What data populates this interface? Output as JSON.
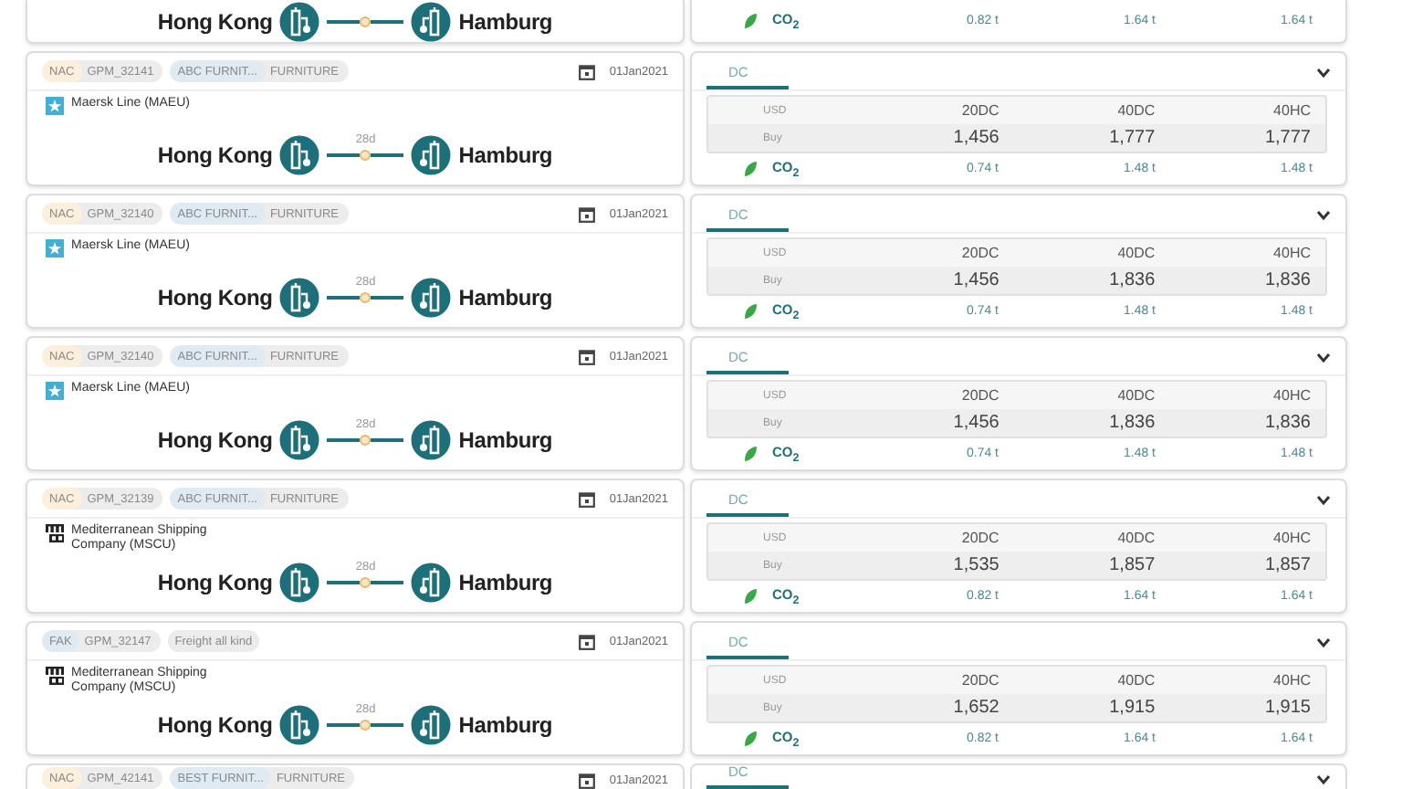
{
  "rows": [
    {
      "route": {
        "origin": "Hong Kong",
        "destination": "Hamburg"
      },
      "co2": {
        "label": "CO$_{2}$",
        "values": [
          "0.82 t",
          "1.64 t",
          "1.64 t"
        ]
      }
    },
    {
      "tags": [
        {
          "label": "NAC",
          "detail": "GPM_32141",
          "color": "#fcefdc"
        },
        {
          "label": "ABC FURNIT...",
          "detail": "FURNITURE",
          "color": "#dfeaf3"
        }
      ],
      "date": "01Jan2021",
      "carrier": {
        "name": "Maersk Line (MAEU)",
        "kind": "maersk"
      },
      "route": {
        "origin": "Hong Kong",
        "duration": "28d",
        "destination": "Hamburg"
      },
      "tabs": [
        {
          "label": "DC",
          "selected": true
        }
      ],
      "table": {
        "currency": "USD",
        "columns": [
          "20DC",
          "40DC",
          "40HC"
        ],
        "rows": [
          {
            "label": "Buy",
            "values": [
              "1,456",
              "1,777",
              "1,777"
            ]
          }
        ]
      },
      "co2": {
        "label": "CO$_{2}$",
        "values": [
          "0.74 t",
          "1.48 t",
          "1.48 t"
        ]
      }
    },
    {
      "tags": [
        {
          "label": "NAC",
          "detail": "GPM_32140",
          "color": "#fcefdc"
        },
        {
          "label": "ABC FURNIT...",
          "detail": "FURNITURE",
          "color": "#dfeaf3"
        }
      ],
      "date": "01Jan2021",
      "carrier": {
        "name": "Maersk Line (MAEU)",
        "kind": "maersk"
      },
      "route": {
        "origin": "Hong Kong",
        "duration": "28d",
        "destination": "Hamburg"
      },
      "tabs": [
        {
          "label": "DC",
          "selected": true
        }
      ],
      "table": {
        "currency": "USD",
        "columns": [
          "20DC",
          "40DC",
          "40HC"
        ],
        "rows": [
          {
            "label": "Buy",
            "values": [
              "1,456",
              "1,836",
              "1,836"
            ]
          }
        ]
      },
      "co2": {
        "label": "CO$_{2}$",
        "values": [
          "0.74 t",
          "1.48 t",
          "1.48 t"
        ]
      }
    },
    {
      "tags": [
        {
          "label": "NAC",
          "detail": "GPM_32140",
          "color": "#fcefdc"
        },
        {
          "label": "ABC FURNIT...",
          "detail": "FURNITURE",
          "color": "#dfeaf3"
        }
      ],
      "date": "01Jan2021",
      "carrier": {
        "name": "Maersk Line (MAEU)",
        "kind": "maersk"
      },
      "route": {
        "origin": "Hong Kong",
        "duration": "28d",
        "destination": "Hamburg"
      },
      "tabs": [
        {
          "label": "DC",
          "selected": true
        }
      ],
      "table": {
        "currency": "USD",
        "columns": [
          "20DC",
          "40DC",
          "40HC"
        ],
        "rows": [
          {
            "label": "Buy",
            "values": [
              "1,456",
              "1,836",
              "1,836"
            ]
          }
        ]
      },
      "co2": {
        "label": "CO$_{2}$",
        "values": [
          "0.74 t",
          "1.48 t",
          "1.48 t"
        ]
      }
    },
    {
      "tags": [
        {
          "label": "NAC",
          "detail": "GPM_32139",
          "color": "#fcefdc"
        },
        {
          "label": "ABC FURNIT...",
          "detail": "FURNITURE",
          "color": "#dfeaf3"
        }
      ],
      "date": "01Jan2021",
      "carrier": {
        "name": "Mediterranean Shipping Company (MSCU)",
        "kind": "msc"
      },
      "route": {
        "origin": "Hong Kong",
        "duration": "28d",
        "destination": "Hamburg"
      },
      "tabs": [
        {
          "label": "DC",
          "selected": true
        }
      ],
      "table": {
        "currency": "USD",
        "columns": [
          "20DC",
          "40DC",
          "40HC"
        ],
        "rows": [
          {
            "label": "Buy",
            "values": [
              "1,535",
              "1,857",
              "1,857"
            ]
          }
        ]
      },
      "co2": {
        "label": "CO$_{2}$",
        "values": [
          "0.82 t",
          "1.64 t",
          "1.64 t"
        ]
      }
    },
    {
      "tags": [
        {
          "label": "FAK",
          "detail": "GPM_32147",
          "color": "#dfeaf3"
        },
        {
          "label": "Freight all kind",
          "color": "#ececec"
        }
      ],
      "date": "01Jan2021",
      "carrier": {
        "name": "Mediterranean Shipping Company (MSCU)",
        "kind": "msc"
      },
      "route": {
        "origin": "Hong Kong",
        "duration": "28d",
        "destination": "Hamburg"
      },
      "tabs": [
        {
          "label": "DC",
          "selected": true
        }
      ],
      "table": {
        "currency": "USD",
        "columns": [
          "20DC",
          "40DC",
          "40HC"
        ],
        "rows": [
          {
            "label": "Buy",
            "values": [
              "1,652",
              "1,915",
              "1,915"
            ]
          }
        ]
      },
      "co2": {
        "label": "CO$_{2}$",
        "values": [
          "0.82 t",
          "1.64 t",
          "1.64 t"
        ]
      }
    },
    {
      "tags": [
        {
          "label": "NAC",
          "detail": "GPM_42141",
          "color": "#fcefdc"
        },
        {
          "label": "BEST FURNIT...",
          "detail": "FURNITURE",
          "color": "#dfeaf3"
        }
      ],
      "date": "01Jan2021",
      "tabs": [
        {
          "label": "DC",
          "selected": true
        }
      ]
    }
  ]
}
